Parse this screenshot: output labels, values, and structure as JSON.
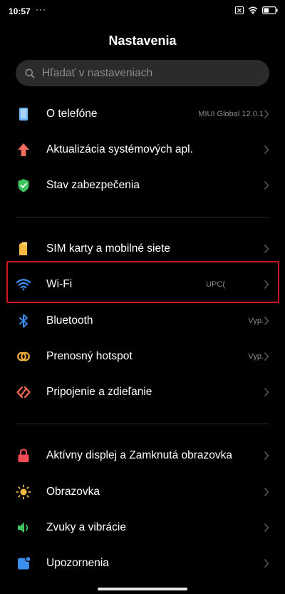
{
  "status_bar": {
    "time": "10:57",
    "dots": "···",
    "battery_level": 0.45
  },
  "header": {
    "title": "Nastavenia"
  },
  "search": {
    "placeholder": "Hľadať v nastaveniach"
  },
  "sections": [
    [
      {
        "label": "O telefóne",
        "value": "MIUI Global 12.0.1",
        "icon": "phone-info-icon",
        "color": "#5aa9f2"
      },
      {
        "label": "Aktualizácia systémových apl.",
        "value": "",
        "icon": "update-arrow-icon",
        "color": "#f26b5b"
      },
      {
        "label": "Stav zabezpečenia",
        "value": "",
        "icon": "security-shield-icon",
        "color": "#3ec45f"
      }
    ],
    [
      {
        "label": "SIM karty a mobilné siete",
        "value": "",
        "icon": "sim-card-icon",
        "color": "#f5b93f"
      },
      {
        "label": "Wi-Fi",
        "value": "UPC(",
        "icon": "wifi-icon",
        "color": "#3b8ff0"
      },
      {
        "label": "Bluetooth",
        "value": "Vyp.",
        "icon": "bluetooth-icon",
        "color": "#3b8ff0"
      },
      {
        "label": "Prenosný hotspot",
        "value": "Vyp.",
        "icon": "hotspot-icon",
        "color": "#f2b33d"
      },
      {
        "label": "Pripojenie a zdieľanie",
        "value": "",
        "icon": "connection-sharing-icon",
        "color": "#f06a4f"
      }
    ],
    [
      {
        "label": "Aktívny displej a Zamknutá obrazovka",
        "value": "",
        "icon": "lock-icon",
        "color": "#f04b55"
      },
      {
        "label": "Obrazovka",
        "value": "",
        "icon": "brightness-icon",
        "color": "#f5b93f"
      },
      {
        "label": "Zvuky a vibrácie",
        "value": "",
        "icon": "speaker-icon",
        "color": "#3ec45f"
      },
      {
        "label": "Upozornenia",
        "value": "",
        "icon": "notification-icon",
        "color": "#3b8ff0"
      }
    ]
  ],
  "highlighted_item": "Wi-Fi"
}
